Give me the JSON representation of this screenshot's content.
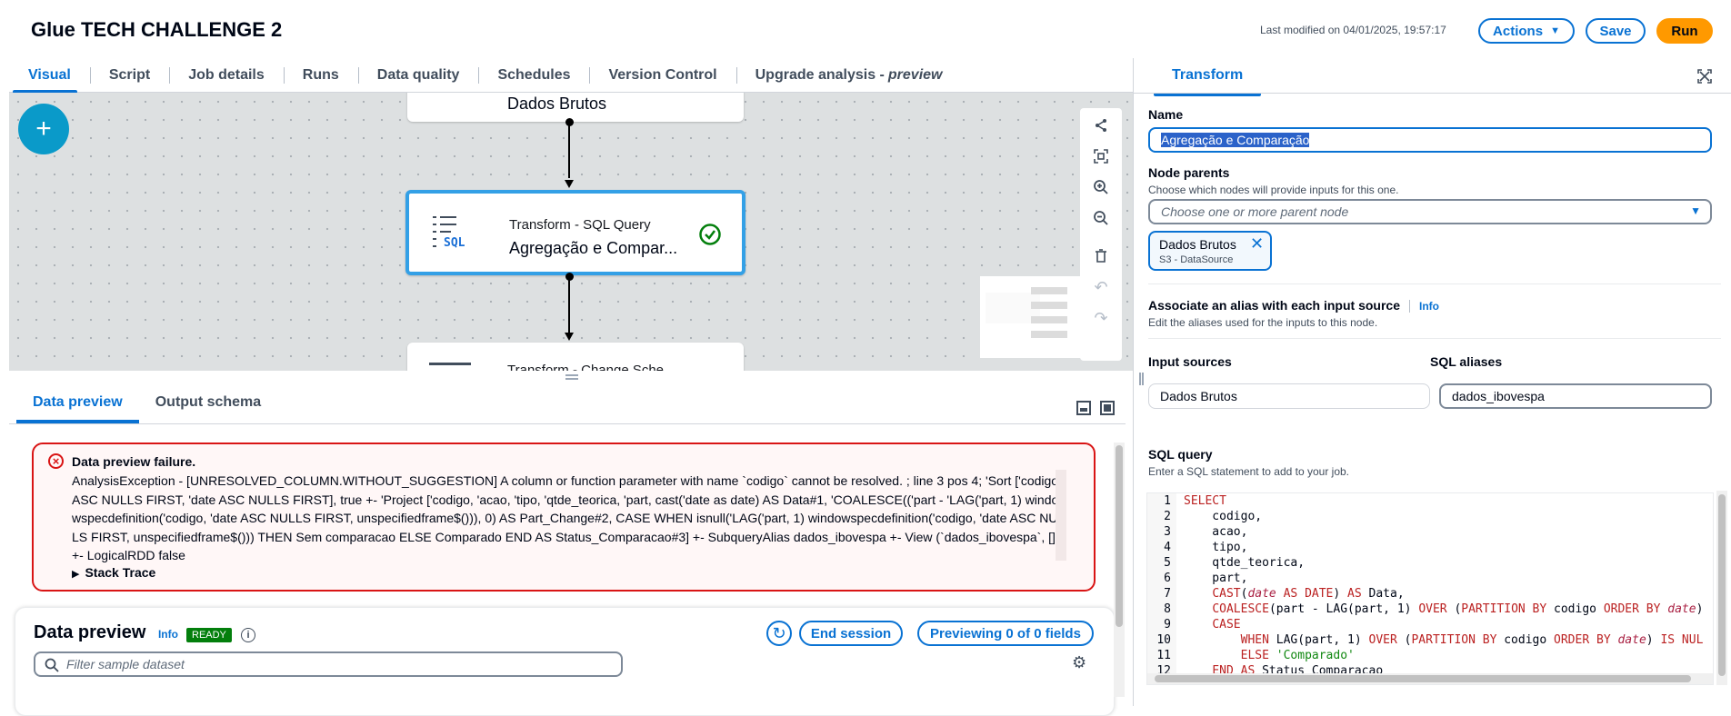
{
  "header": {
    "title": "Glue TECH CHALLENGE 2",
    "last_modified": "Last modified on 04/01/2025, 19:57:17",
    "actions_label": "Actions",
    "save_label": "Save",
    "run_label": "Run"
  },
  "tabs": [
    {
      "label": "Visual"
    },
    {
      "label": "Script"
    },
    {
      "label": "Job details"
    },
    {
      "label": "Runs"
    },
    {
      "label": "Data quality"
    },
    {
      "label": "Schedules"
    },
    {
      "label": "Version Control"
    },
    {
      "label": "Upgrade analysis -",
      "suffix": "preview"
    }
  ],
  "canvas": {
    "nodes": [
      {
        "type": "",
        "name": "Dados Brutos"
      },
      {
        "type": "Transform - SQL Query",
        "name": "Agregação e Compar..."
      },
      {
        "type": "Transform - Change Sche...",
        "name": ""
      }
    ]
  },
  "bottom_tabs": [
    {
      "label": "Data preview"
    },
    {
      "label": "Output schema"
    }
  ],
  "error": {
    "title": "Data preview failure.",
    "message": "AnalysisException - [UNRESOLVED_COLUMN.WITHOUT_SUGGESTION] A column or function parameter with name `codigo` cannot be resolved. ; line 3 pos 4; 'Sort ['codigo ASC NULLS FIRST, 'date ASC NULLS FIRST], true +- 'Project ['codigo, 'acao, 'tipo, 'qtde_teorica, 'part, cast('date as date) AS Data#1, 'COALESCE(('part - 'LAG('part, 1) windowspecdefinition('codigo, 'date ASC NULLS FIRST, unspecifiedframe$())), 0) AS Part_Change#2, CASE WHEN isnull('LAG('part, 1) windowspecdefinition('codigo, 'date ASC NULLS FIRST, unspecifiedframe$())) THEN Sem comparacao ELSE Comparado END AS Status_Comparacao#3] +- SubqueryAlias dados_ibovespa +- View (`dados_ibovespa`, []) +- LogicalRDD false",
    "stack_trace_label": "Stack Trace"
  },
  "data_preview": {
    "title": "Data preview",
    "info": "Info",
    "status": "READY",
    "end_session_label": "End session",
    "previewing_label": "Previewing 0 of 0 fields",
    "filter_placeholder": "Filter sample dataset"
  },
  "right_panel": {
    "tab_label": "Transform",
    "name_label": "Name",
    "name_value": "Agregação e Comparação",
    "parents_label": "Node parents",
    "parents_desc": "Choose which nodes will provide inputs for this one.",
    "parents_placeholder": "Choose one or more parent node",
    "token_name": "Dados Brutos",
    "token_sub": "S3 - DataSource",
    "alias_label": "Associate an alias with each input source",
    "alias_info": "Info",
    "alias_desc": "Edit the aliases used for the inputs to this node.",
    "input_sources_label": "Input sources",
    "sql_aliases_label": "SQL aliases",
    "input_source_value": "Dados Brutos",
    "sql_alias_value": "dados_ibovespa",
    "sql_query_label": "SQL query",
    "sql_query_desc": "Enter a SQL statement to add to your job."
  },
  "colors": {
    "accent": "#0972d3",
    "run": "#ff9900",
    "error": "#d91515",
    "ready": "#037f0c",
    "canvas_bg": "#dde0e1",
    "node_selected": "#33a0e6"
  }
}
